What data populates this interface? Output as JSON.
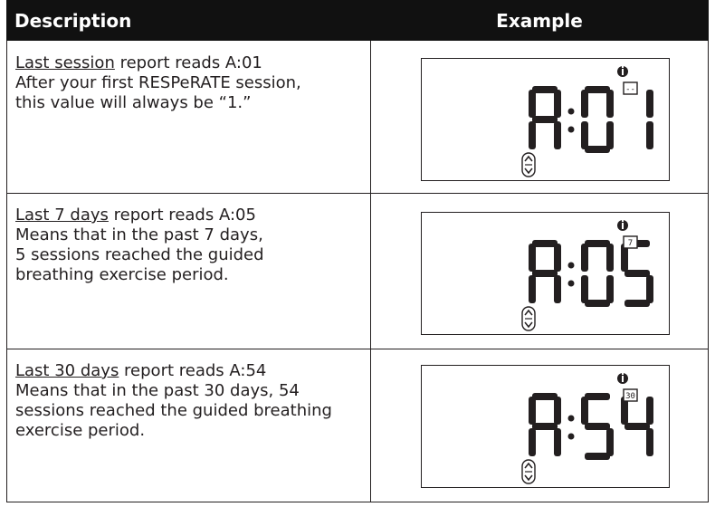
{
  "header": {
    "description": "Description",
    "example": "Example"
  },
  "rows": [
    {
      "title": "Last session",
      "title_rest": " report reads A:01",
      "lines": [
        "After your first RESPeRATE session,",
        "this value will always be “1.”"
      ],
      "display": {
        "letter": "A",
        "digits": "01",
        "period_icon": "--"
      }
    },
    {
      "title": "Last 7 days",
      "title_rest": " report reads A:05",
      "lines": [
        "Means that in the past 7 days,",
        "5 sessions reached the guided",
        "breathing exercise period."
      ],
      "display": {
        "letter": "A",
        "digits": "05",
        "period_icon": "7"
      }
    },
    {
      "title": "Last 30 days",
      "title_rest": " report reads A:54",
      "lines": [
        "Means that in the past 30 days, 54",
        "sessions reached the guided breathing",
        "exercise period."
      ],
      "display": {
        "letter": "A",
        "digits": "54",
        "period_icon": "30"
      }
    }
  ],
  "icons": [
    "info-icon",
    "scroll-arrows-icon",
    "period-badge-icon"
  ]
}
